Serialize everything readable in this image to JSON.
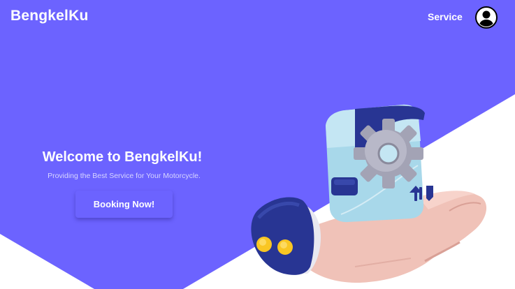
{
  "nav": {
    "brand": "BengkelKu",
    "link_service": "Service",
    "avatar_icon": "user-avatar-icon"
  },
  "hero": {
    "title": "Welcome to BengkelKu!",
    "subtitle": "Providing the Best Service for Your Motorcycle.",
    "cta_label": "Booking Now!",
    "illustration": "hand-holding-service-box-illustration"
  },
  "colors": {
    "primary": "#6c63ff",
    "white": "#ffffff",
    "box_blue": "#a8d8ea",
    "sleeve_blue": "#283593",
    "gear_gray": "#9e9eae",
    "skin": "#f0c2b8"
  }
}
